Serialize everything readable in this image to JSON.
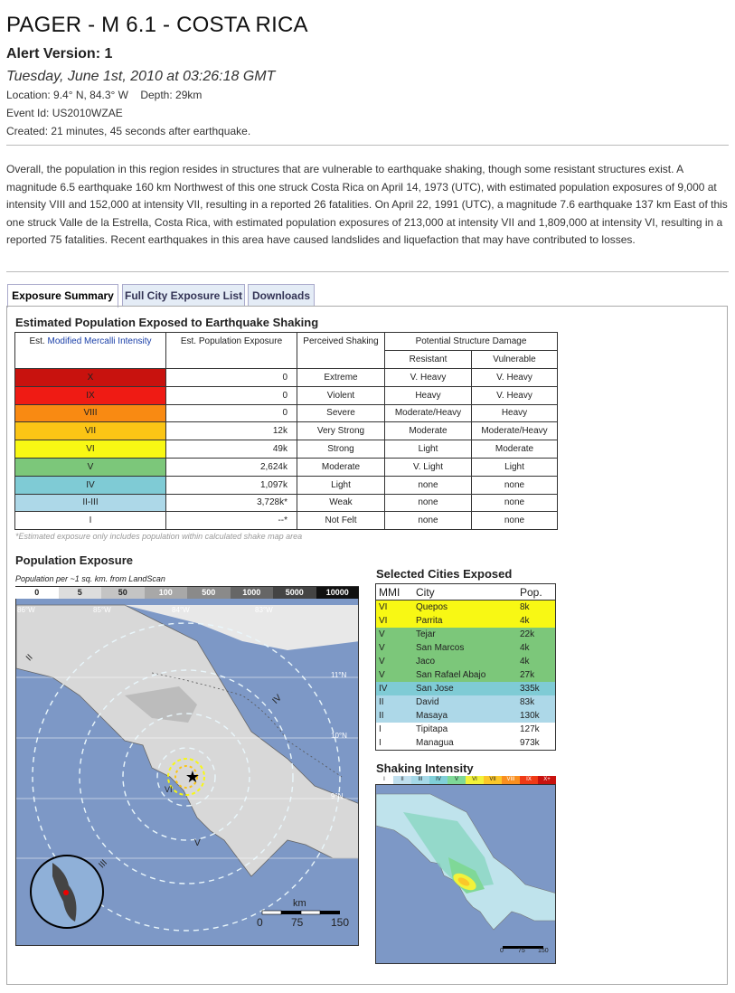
{
  "header": {
    "title": "PAGER - M 6.1 - COSTA RICA",
    "alert_version": "Alert Version: 1",
    "datetime": "Tuesday, June 1st, 2010 at 03:26:18 GMT",
    "location": "Location: 9.4° N, 84.3° W    Depth: 29km",
    "event_id": "Event Id: US2010WZAE",
    "created": "Created: 21 minutes, 45 seconds after earthquake."
  },
  "summary": "Overall, the population in this region resides in structures that are vulnerable to earthquake shaking, though some resistant structures exist. A magnitude 6.5 earthquake 160 km Northwest of this one struck Costa Rica on April 14, 1973 (UTC), with estimated population exposures of 9,000 at intensity VIII and 152,000 at intensity VII, resulting in a reported 26 fatalities. On April 22, 1991 (UTC), a magnitude 7.6 earthquake 137 km East of this one struck Valle de la Estrella, Costa Rica, with estimated population exposures of 213,000 at intensity VII and 1,809,000 at intensity VI, resulting in a reported 75 fatalities. Recent earthquakes in this area have caused landslides and liquefaction that may have contributed to losses.",
  "tabs": [
    "Exposure Summary",
    "Full City Exposure List",
    "Downloads"
  ],
  "exposure": {
    "title": "Estimated Population Exposed to Earthquake Shaking",
    "col_mmi_prefix": "Est. ",
    "col_mmi_link": "Modified Mercalli Intensity",
    "col_pop": "Est. Population Exposure",
    "col_shaking": "Perceived Shaking",
    "col_damage": "Potential Structure Damage",
    "col_resistant": "Resistant",
    "col_vulnerable": "Vulnerable",
    "rows": [
      {
        "mmi": "X",
        "color": "#c8120e",
        "pop": "0",
        "shaking": "Extreme",
        "resistant": "V. Heavy",
        "vulnerable": "V. Heavy"
      },
      {
        "mmi": "IX",
        "color": "#ef1b14",
        "pop": "0",
        "shaking": "Violent",
        "resistant": "Heavy",
        "vulnerable": "V. Heavy"
      },
      {
        "mmi": "VIII",
        "color": "#f98a12",
        "pop": "0",
        "shaking": "Severe",
        "resistant": "Moderate/Heavy",
        "vulnerable": "Heavy"
      },
      {
        "mmi": "VII",
        "color": "#fbc515",
        "pop": "12k",
        "shaking": "Very Strong",
        "resistant": "Moderate",
        "vulnerable": "Moderate/Heavy"
      },
      {
        "mmi": "VI",
        "color": "#f8f814",
        "pop": "49k",
        "shaking": "Strong",
        "resistant": "Light",
        "vulnerable": "Moderate"
      },
      {
        "mmi": "V",
        "color": "#7cc77a",
        "pop": "2,624k",
        "shaking": "Moderate",
        "resistant": "V. Light",
        "vulnerable": "Light"
      },
      {
        "mmi": "IV",
        "color": "#7fcbd5",
        "pop": "1,097k",
        "shaking": "Light",
        "resistant": "none",
        "vulnerable": "none"
      },
      {
        "mmi": "II-III",
        "color": "#add8e8",
        "pop": "3,728k*",
        "shaking": "Weak",
        "resistant": "none",
        "vulnerable": "none"
      },
      {
        "mmi": "I",
        "color": "#ffffff",
        "pop": "--*",
        "shaking": "Not Felt",
        "resistant": "none",
        "vulnerable": "none"
      }
    ],
    "note": "*Estimated exposure only includes population within calculated shake map area"
  },
  "population_map": {
    "title": "Population Exposure",
    "subtitle": "Population per ~1 sq. km. from LandScan",
    "legend": [
      "0",
      "5",
      "50",
      "100",
      "500",
      "1000",
      "5000",
      "10000"
    ],
    "lon_labels": [
      "86°W",
      "85°W",
      "84°W",
      "83°W"
    ],
    "lat_labels": [
      "11°N",
      "10°N",
      "9°N"
    ],
    "ring_labels": [
      "II",
      "III",
      "IV",
      "V",
      "VI"
    ],
    "scale_title": "km",
    "scale_ticks": [
      "0",
      "75",
      "150"
    ]
  },
  "cities": {
    "title": "Selected Cities Exposed",
    "headers": [
      "MMI",
      "City",
      "Pop."
    ],
    "rows": [
      {
        "mmi": "VI",
        "city": "Quepos",
        "pop": "8k",
        "color": "#f8f814"
      },
      {
        "mmi": "VI",
        "city": "Parrita",
        "pop": "4k",
        "color": "#f8f814"
      },
      {
        "mmi": "V",
        "city": "Tejar",
        "pop": "22k",
        "color": "#7cc77a"
      },
      {
        "mmi": "V",
        "city": "San Marcos",
        "pop": "4k",
        "color": "#7cc77a"
      },
      {
        "mmi": "V",
        "city": "Jaco",
        "pop": "4k",
        "color": "#7cc77a"
      },
      {
        "mmi": "V",
        "city": "San Rafael Abajo",
        "pop": "27k",
        "color": "#7cc77a"
      },
      {
        "mmi": "IV",
        "city": "San Jose",
        "pop": "335k",
        "color": "#7fcbd5"
      },
      {
        "mmi": "II",
        "city": "David",
        "pop": "83k",
        "color": "#add8e8"
      },
      {
        "mmi": "II",
        "city": "Masaya",
        "pop": "130k",
        "color": "#add8e8"
      },
      {
        "mmi": "I",
        "city": "Tipitapa",
        "pop": "127k",
        "color": "#ffffff"
      },
      {
        "mmi": "I",
        "city": "Managua",
        "pop": "973k",
        "color": "#ffffff"
      }
    ]
  },
  "intensity_map": {
    "title": "Shaking Intensity",
    "scale": [
      "I",
      "II",
      "III",
      "IV",
      "V",
      "VI",
      "VII",
      "VIII",
      "IX",
      "X+"
    ],
    "scale_colors": [
      "#ffffff",
      "#c0dfee",
      "#a6d9e8",
      "#80cfd8",
      "#7fd897",
      "#f2f23a",
      "#fbc72a",
      "#f98f20",
      "#ef3a16",
      "#c8120e"
    ],
    "scale_ticks": [
      "0",
      "75",
      "150"
    ]
  }
}
